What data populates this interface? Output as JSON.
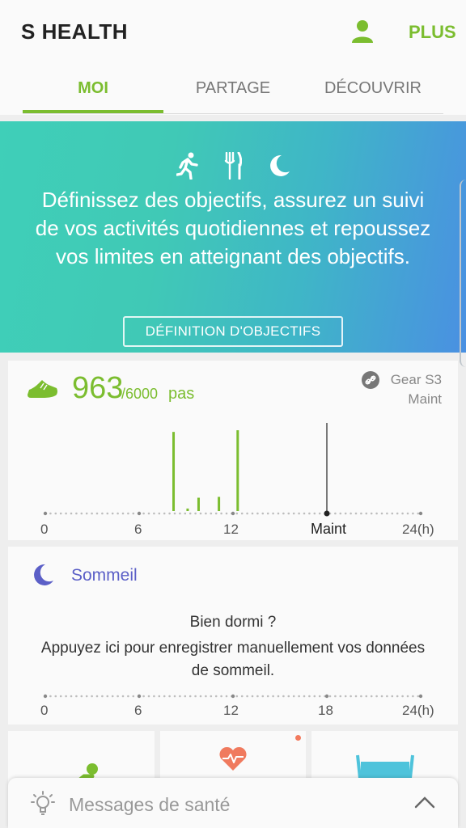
{
  "header": {
    "title": "S HEALTH",
    "plus_label": "PLUS"
  },
  "tabs": [
    {
      "label": "MOI",
      "active": true
    },
    {
      "label": "PARTAGE",
      "active": false
    },
    {
      "label": "DÉCOUVRIR",
      "active": false
    }
  ],
  "banner": {
    "icons": [
      "running-icon",
      "fork-knife-icon",
      "moon-icon"
    ],
    "text": "Définissez des objectifs, assurez un suivi de vos activités quotidiennes et repoussez vos limites en atteignant des objectifs.",
    "button_label": "DÉFINITION D'OBJECTIFS"
  },
  "steps": {
    "value": "963",
    "goal": "/6000",
    "unit": "pas",
    "device": "Gear S3",
    "device_status": "Maint",
    "axis_labels": [
      "0",
      "6",
      "12",
      "Maint",
      "24(h)"
    ],
    "now_hour": 18,
    "bars": [
      {
        "hour": 8.2,
        "value": 0.95
      },
      {
        "hour": 9.1,
        "value": 0.03
      },
      {
        "hour": 9.8,
        "value": 0.16
      },
      {
        "hour": 11.1,
        "value": 0.17
      },
      {
        "hour": 12.3,
        "value": 0.97
      }
    ],
    "accent_color": "#7bbd2f"
  },
  "sleep": {
    "title": "Sommeil",
    "question": "Bien dormi ?",
    "message": "Appuyez ici pour enregistrer manuellement vos données de sommeil.",
    "axis_labels": [
      "0",
      "6",
      "12",
      "18",
      "24(h)"
    ],
    "accent_color": "#5b5fc7"
  },
  "mini_cards": [
    {
      "icon": "activity-icon"
    },
    {
      "icon": "heart-rate-icon",
      "has_notification": true
    },
    {
      "icon": "water-icon"
    }
  ],
  "messages": {
    "label": "Messages de santé"
  }
}
